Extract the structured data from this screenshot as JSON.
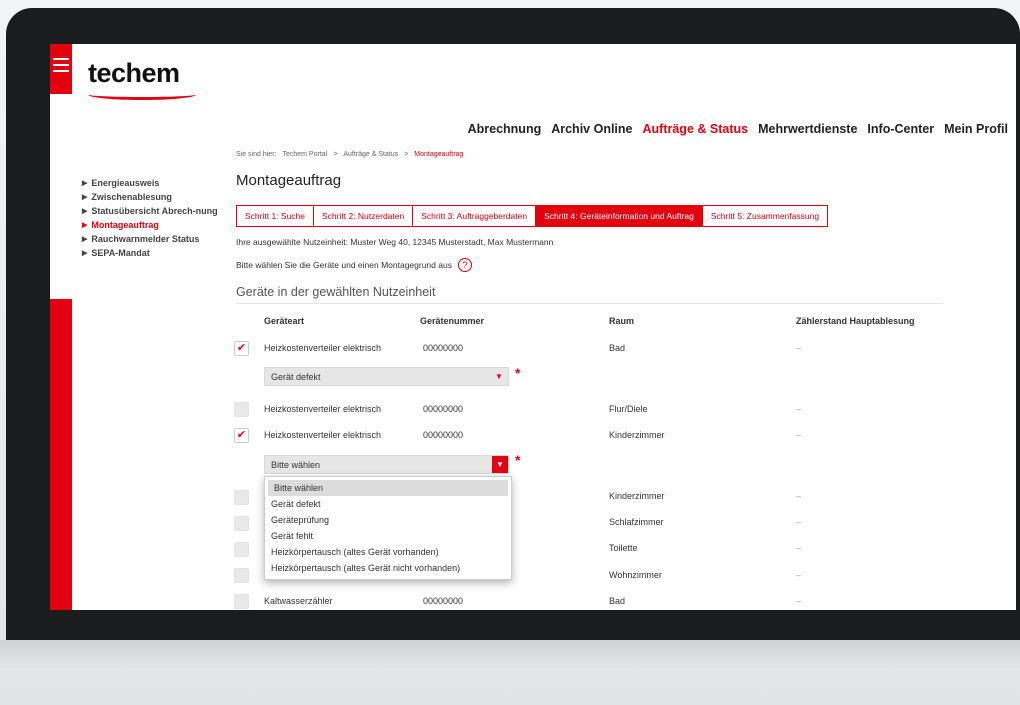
{
  "logo": "techem",
  "topnav": [
    "Abrechnung",
    "Archiv Online",
    "Aufträge & Status",
    "Mehrwertdienste",
    "Info-Center",
    "Mein Profil"
  ],
  "topnav_active": "Aufträge & Status",
  "breadcrumb": {
    "prefix": "Sie sind hier:",
    "items": [
      "Techem Portal",
      "Aufträge & Status",
      "Montageauftrag"
    ],
    "separator": ">"
  },
  "sidenav": [
    {
      "label": "Energieausweis",
      "active": false
    },
    {
      "label": "Zwischenablesung",
      "active": false
    },
    {
      "label": "Statusübersicht Abrech-nung",
      "active": false
    },
    {
      "label": "Montageauftrag",
      "active": true
    },
    {
      "label": "Rauchwarnmelder Status",
      "active": false
    },
    {
      "label": "SEPA-Mandat",
      "active": false
    }
  ],
  "page_title": "Montageauftrag",
  "steps": [
    {
      "label": "Schritt 1: Suche",
      "active": false
    },
    {
      "label": "Schritt 2: Nutzerdaten",
      "active": false
    },
    {
      "label": "Schritt 3: Auftraggeberdaten",
      "active": false
    },
    {
      "label": "Schritt 4: Geräteinformation und Auftrag",
      "active": true
    },
    {
      "label": "Schritt 5: Zusammenfassung",
      "active": false
    }
  ],
  "info_unit": "Ihre ausgewählte Nutzeinheit: Muster Weg 40, 12345 Musterstadt, Max Mustermann",
  "info_instruction": "Bitte wählen Sie die Geräte und einen Montagegrund aus",
  "help_icon": "?",
  "section_title": "Geräte in der gewählten Nutzeinheit",
  "table": {
    "headers": [
      "Geräteart",
      "Gerätenummer",
      "Raum",
      "Zählerstand Hauptablesung"
    ],
    "rows": [
      {
        "checked": true,
        "type": "Heizkostenverteiler elektrisch",
        "number": "00000000",
        "room": "Bad",
        "reading": "–"
      },
      {
        "checked": false,
        "type": "Heizkostenverteiler elektrisch",
        "number": "00000000",
        "room": "Flur/Diele",
        "reading": "–"
      },
      {
        "checked": true,
        "type": "Heizkostenverteiler elektrisch",
        "number": "00000000",
        "room": "Kinderzimmer",
        "reading": "–"
      },
      {
        "checked": false,
        "type": "",
        "number": "",
        "room": "Kinderzimmer",
        "reading": "–"
      },
      {
        "checked": false,
        "type": "",
        "number": "",
        "room": "Schlafzimmer",
        "reading": "–"
      },
      {
        "checked": false,
        "type": "",
        "number": "",
        "room": "Toilette",
        "reading": "–"
      },
      {
        "checked": false,
        "type": "",
        "number": "",
        "room": "Wohnzimmer",
        "reading": "–"
      },
      {
        "checked": false,
        "type": "Kaltwasserzähler",
        "number": "00000000",
        "room": "Bad",
        "reading": "–"
      }
    ]
  },
  "select1": {
    "value": "Gerät defekt"
  },
  "select2": {
    "value": "Bitte wählen"
  },
  "required_mark": "*",
  "dropdown_options": [
    "Bitte wählen",
    "Gerät defekt",
    "Geräteprüfung",
    "Gerät fehlt",
    "Heizkörpertausch (altes Gerät vorhanden)",
    "Heizkörpertausch (altes Gerät nicht vorhanden)"
  ],
  "colors": {
    "accent": "#e3000f",
    "bezel": "#1b1c1e"
  }
}
